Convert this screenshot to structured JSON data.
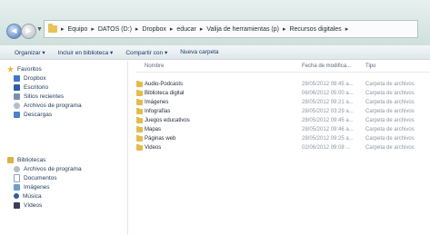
{
  "address": {
    "crumbs": [
      "Equipo",
      "DATOS (D:)",
      "Dropbox",
      "educar",
      "Valija de herramientas (p)",
      "Recursos digitales"
    ]
  },
  "toolbar": {
    "organize": "Organizar ▾",
    "include": "Incluir en biblioteca ▾",
    "share": "Compartir con ▾",
    "new_folder": "Nueva carpeta"
  },
  "nav": {
    "favorites_label": "Favoritos",
    "favorites": [
      "Dropbox",
      "Escritorio",
      "Sitios recientes",
      "Archivos de programa",
      "Descargas"
    ],
    "libraries_label": "Bibliotecas",
    "libraries": [
      "Archivos de programa",
      "Documentos",
      "Imágenes",
      "Música",
      "Vídeos"
    ]
  },
  "columns": {
    "name": "Nombre",
    "date": "Fecha de modifica...",
    "type": "Tipo"
  },
  "files": [
    {
      "name": "Audio-Podcasts",
      "date": "28/05/2012 09:45 a...",
      "type": "Carpeta de archivos"
    },
    {
      "name": "Biblioteca digital",
      "date": "06/06/2012 05:00 a...",
      "type": "Carpeta de archivos"
    },
    {
      "name": "Imágenes",
      "date": "28/05/2012 09:21 a...",
      "type": "Carpeta de archivos"
    },
    {
      "name": "Infografías",
      "date": "28/05/2012 03:29 a...",
      "type": "Carpeta de archivos"
    },
    {
      "name": "Juegos educativos",
      "date": "28/05/2012 09:45 a...",
      "type": "Carpeta de archivos"
    },
    {
      "name": "Mapas",
      "date": "28/05/2012 09:46 a...",
      "type": "Carpeta de archivos"
    },
    {
      "name": "Páginas web",
      "date": "28/05/2012 09:25 a...",
      "type": "Carpeta de archivos"
    },
    {
      "name": "Videos",
      "date": "02/06/2012 09:08 ...",
      "type": "Carpeta de archivos"
    }
  ],
  "colors": {
    "address_bg": "#cfe0dc",
    "folder": "#e6bb4c",
    "nav_text": "#1f3855"
  }
}
